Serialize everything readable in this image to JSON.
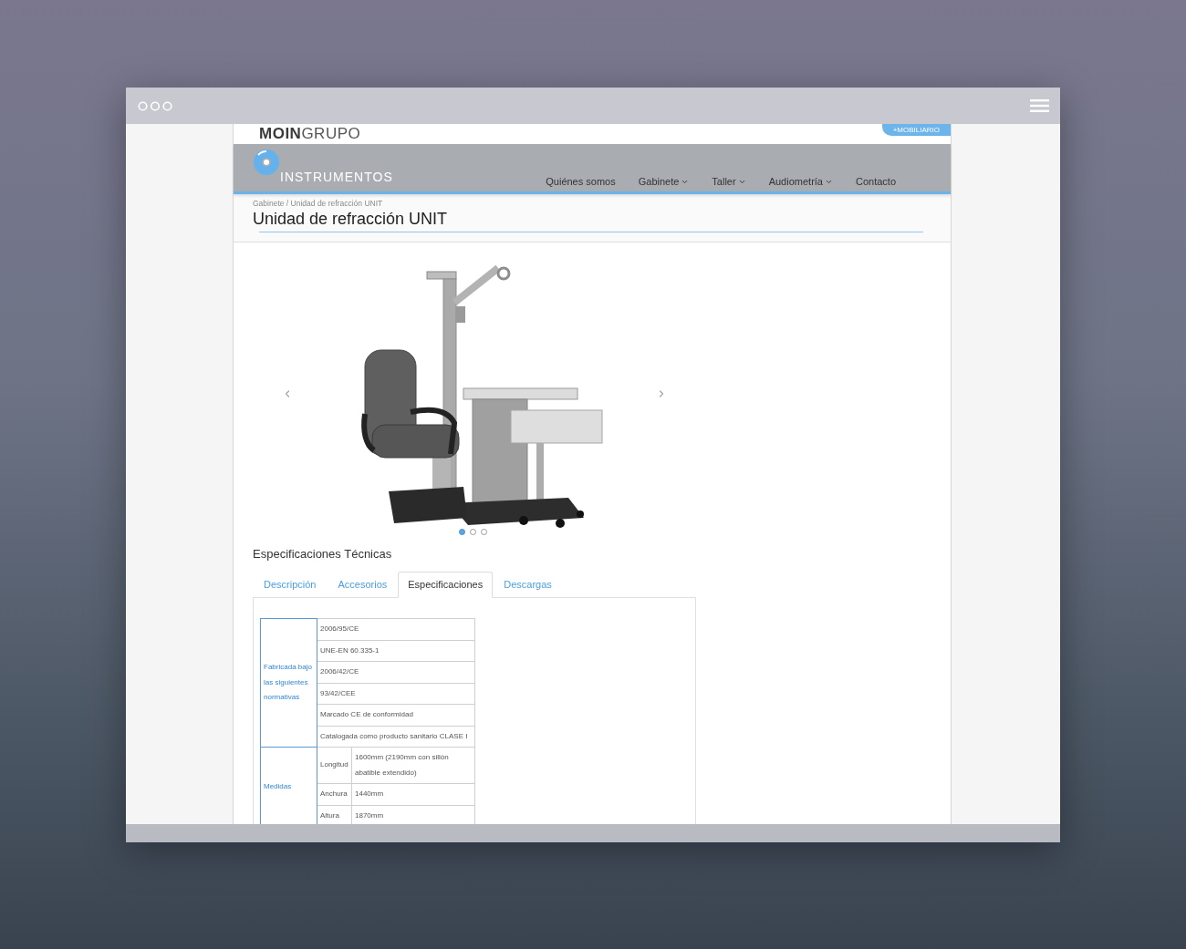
{
  "top_bar": {
    "logo_bold": "MOIN",
    "logo_light": "GRUPO",
    "link": "+MOBILIARIO"
  },
  "header": {
    "brand": "INSTRUMENTOS",
    "nav": [
      {
        "label": "Quiénes somos",
        "has_menu": false
      },
      {
        "label": "Gabinete",
        "has_menu": true
      },
      {
        "label": "Taller",
        "has_menu": true
      },
      {
        "label": "Audiometría",
        "has_menu": true
      },
      {
        "label": "Contacto",
        "has_menu": false
      }
    ]
  },
  "breadcrumb": "Gabinete / Unidad de refracción UNIT",
  "title": "Unidad de refracción UNIT",
  "carousel": {
    "dots": [
      {
        "selected": true
      },
      {
        "selected": false
      },
      {
        "selected": false
      }
    ]
  },
  "specs_heading": "Especificaciones Técnicas",
  "tabs": [
    {
      "label": "Descripción",
      "selected": false
    },
    {
      "label": "Accesorios",
      "selected": false
    },
    {
      "label": "Especificaciones",
      "selected": true
    },
    {
      "label": "Descargas",
      "selected": false
    }
  ],
  "spec_table": [
    {
      "group": "Fabricada bajo las siguientes normativas",
      "rows": [
        {
          "value": "2006/95/CE"
        },
        {
          "value": "UNE-EN 60.335-1"
        },
        {
          "value": "2006/42/CE"
        },
        {
          "value": "93/42/CEE"
        },
        {
          "value": "Marcado CE de conformidad"
        },
        {
          "value": "Catalogada como producto sanitario CLASE I"
        }
      ]
    },
    {
      "group": "Medidas",
      "rows": [
        {
          "label": "Longitud",
          "value": "1600mm (2190mm con sillón abatible extendido)"
        },
        {
          "label": "Anchura",
          "value": "1440mm"
        },
        {
          "label": "Altura",
          "value": "1870mm"
        }
      ]
    }
  ]
}
